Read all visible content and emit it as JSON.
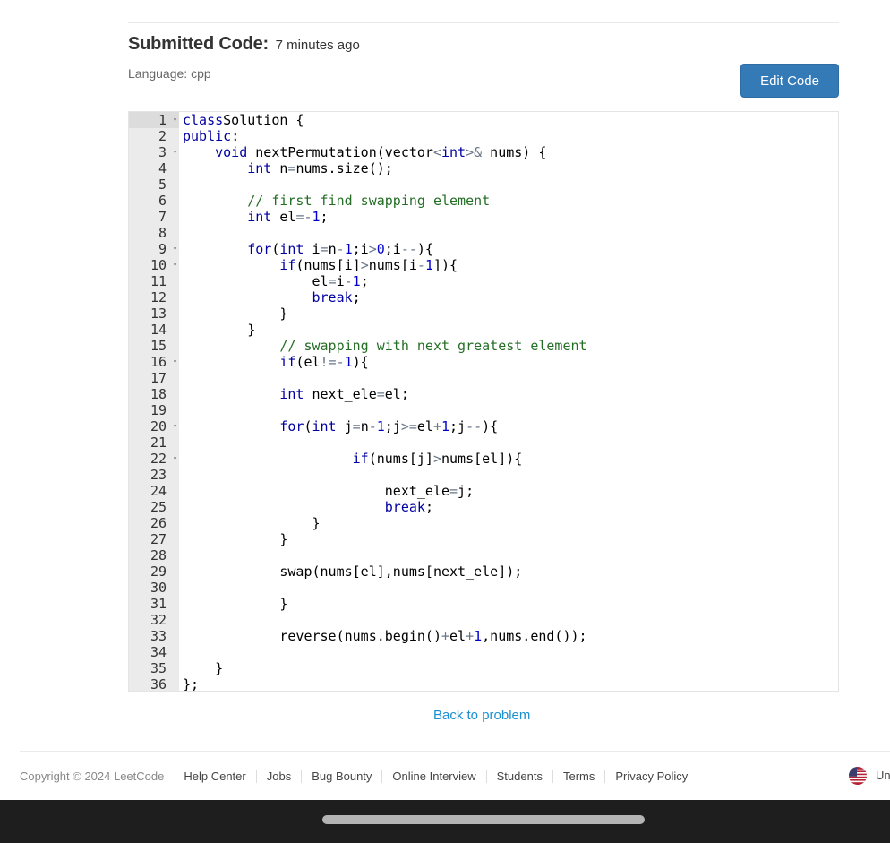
{
  "header": {
    "title_label": "Submitted Code:",
    "time_ago": "7 minutes ago",
    "language": "Language: cpp",
    "edit_button": "Edit Code"
  },
  "code_lines": [
    {
      "n": "1",
      "fold": true,
      "segs": [
        [
          "kw",
          "class"
        ],
        [
          "",
          "Solution {"
        ]
      ]
    },
    {
      "n": "2",
      "fold": false,
      "segs": [
        [
          "kw",
          "public"
        ],
        [
          "",
          ":"
        ]
      ]
    },
    {
      "n": "3",
      "fold": true,
      "segs": [
        [
          "",
          "    "
        ],
        [
          "kw",
          "void"
        ],
        [
          "",
          " nextPermutation(vector"
        ],
        [
          "op",
          "<"
        ],
        [
          "typ",
          "int"
        ],
        [
          "op",
          ">&"
        ],
        [
          "",
          " nums) {"
        ]
      ]
    },
    {
      "n": "4",
      "fold": false,
      "segs": [
        [
          "",
          "        "
        ],
        [
          "typ",
          "int"
        ],
        [
          "",
          " n"
        ],
        [
          "op",
          "="
        ],
        [
          "",
          "nums.size();"
        ]
      ]
    },
    {
      "n": "5",
      "fold": false,
      "segs": [
        [
          "",
          ""
        ]
      ]
    },
    {
      "n": "6",
      "fold": false,
      "segs": [
        [
          "",
          "        "
        ],
        [
          "cm",
          "// first find swapping element"
        ]
      ]
    },
    {
      "n": "7",
      "fold": false,
      "segs": [
        [
          "",
          "        "
        ],
        [
          "typ",
          "int"
        ],
        [
          "",
          " el"
        ],
        [
          "op",
          "=-"
        ],
        [
          "num",
          "1"
        ],
        [
          "",
          ";"
        ]
      ]
    },
    {
      "n": "8",
      "fold": false,
      "segs": [
        [
          "",
          ""
        ]
      ]
    },
    {
      "n": "9",
      "fold": true,
      "segs": [
        [
          "",
          "        "
        ],
        [
          "kw",
          "for"
        ],
        [
          "",
          "("
        ],
        [
          "typ",
          "int"
        ],
        [
          "",
          " i"
        ],
        [
          "op",
          "="
        ],
        [
          "",
          "n"
        ],
        [
          "op",
          "-"
        ],
        [
          "num",
          "1"
        ],
        [
          "",
          ";i"
        ],
        [
          "op",
          ">"
        ],
        [
          "num",
          "0"
        ],
        [
          "",
          ";i"
        ],
        [
          "op",
          "--"
        ],
        [
          "",
          "){"
        ]
      ]
    },
    {
      "n": "10",
      "fold": true,
      "segs": [
        [
          "",
          "            "
        ],
        [
          "kw",
          "if"
        ],
        [
          "",
          "(nums[i]"
        ],
        [
          "op",
          ">"
        ],
        [
          "",
          "nums[i"
        ],
        [
          "op",
          "-"
        ],
        [
          "num",
          "1"
        ],
        [
          "",
          "]){"
        ]
      ]
    },
    {
      "n": "11",
      "fold": false,
      "segs": [
        [
          "",
          "                el"
        ],
        [
          "op",
          "="
        ],
        [
          "",
          "i"
        ],
        [
          "op",
          "-"
        ],
        [
          "num",
          "1"
        ],
        [
          "",
          ";"
        ]
      ]
    },
    {
      "n": "12",
      "fold": false,
      "segs": [
        [
          "",
          "                "
        ],
        [
          "kw",
          "break"
        ],
        [
          "",
          ";"
        ]
      ]
    },
    {
      "n": "13",
      "fold": false,
      "segs": [
        [
          "",
          "            }"
        ]
      ]
    },
    {
      "n": "14",
      "fold": false,
      "segs": [
        [
          "",
          "        }"
        ]
      ]
    },
    {
      "n": "15",
      "fold": false,
      "segs": [
        [
          "",
          "            "
        ],
        [
          "cm",
          "// swapping with next greatest element"
        ]
      ]
    },
    {
      "n": "16",
      "fold": true,
      "segs": [
        [
          "",
          "            "
        ],
        [
          "kw",
          "if"
        ],
        [
          "",
          "(el"
        ],
        [
          "op",
          "!=-"
        ],
        [
          "num",
          "1"
        ],
        [
          "",
          "){"
        ]
      ]
    },
    {
      "n": "17",
      "fold": false,
      "segs": [
        [
          "",
          ""
        ]
      ]
    },
    {
      "n": "18",
      "fold": false,
      "segs": [
        [
          "",
          "            "
        ],
        [
          "typ",
          "int"
        ],
        [
          "",
          " next_ele"
        ],
        [
          "op",
          "="
        ],
        [
          "",
          "el;"
        ]
      ]
    },
    {
      "n": "19",
      "fold": false,
      "segs": [
        [
          "",
          ""
        ]
      ]
    },
    {
      "n": "20",
      "fold": true,
      "segs": [
        [
          "",
          "            "
        ],
        [
          "kw",
          "for"
        ],
        [
          "",
          "("
        ],
        [
          "typ",
          "int"
        ],
        [
          "",
          " j"
        ],
        [
          "op",
          "="
        ],
        [
          "",
          "n"
        ],
        [
          "op",
          "-"
        ],
        [
          "num",
          "1"
        ],
        [
          "",
          ";j"
        ],
        [
          "op",
          ">="
        ],
        [
          "",
          "el"
        ],
        [
          "op",
          "+"
        ],
        [
          "num",
          "1"
        ],
        [
          "",
          ";j"
        ],
        [
          "op",
          "--"
        ],
        [
          "",
          "){"
        ]
      ]
    },
    {
      "n": "21",
      "fold": false,
      "segs": [
        [
          "",
          ""
        ]
      ]
    },
    {
      "n": "22",
      "fold": true,
      "segs": [
        [
          "",
          "                     "
        ],
        [
          "kw",
          "if"
        ],
        [
          "",
          "(nums[j]"
        ],
        [
          "op",
          ">"
        ],
        [
          "",
          "nums[el]){"
        ]
      ]
    },
    {
      "n": "23",
      "fold": false,
      "segs": [
        [
          "",
          ""
        ]
      ]
    },
    {
      "n": "24",
      "fold": false,
      "segs": [
        [
          "",
          "                         next_ele"
        ],
        [
          "op",
          "="
        ],
        [
          "",
          "j;"
        ]
      ]
    },
    {
      "n": "25",
      "fold": false,
      "segs": [
        [
          "",
          "                         "
        ],
        [
          "kw",
          "break"
        ],
        [
          "",
          ";"
        ]
      ]
    },
    {
      "n": "26",
      "fold": false,
      "segs": [
        [
          "",
          "                }"
        ]
      ]
    },
    {
      "n": "27",
      "fold": false,
      "segs": [
        [
          "",
          "            }"
        ]
      ]
    },
    {
      "n": "28",
      "fold": false,
      "segs": [
        [
          "",
          ""
        ]
      ]
    },
    {
      "n": "29",
      "fold": false,
      "segs": [
        [
          "",
          "            swap(nums[el],nums[next_ele]);"
        ]
      ]
    },
    {
      "n": "30",
      "fold": false,
      "segs": [
        [
          "",
          ""
        ]
      ]
    },
    {
      "n": "31",
      "fold": false,
      "segs": [
        [
          "",
          "            }"
        ]
      ]
    },
    {
      "n": "32",
      "fold": false,
      "segs": [
        [
          "",
          ""
        ]
      ]
    },
    {
      "n": "33",
      "fold": false,
      "segs": [
        [
          "",
          "            reverse(nums.begin()"
        ],
        [
          "op",
          "+"
        ],
        [
          "",
          "el"
        ],
        [
          "op",
          "+"
        ],
        [
          "num",
          "1"
        ],
        [
          "",
          ",nums.end());"
        ]
      ]
    },
    {
      "n": "34",
      "fold": false,
      "segs": [
        [
          "",
          ""
        ]
      ]
    },
    {
      "n": "35",
      "fold": false,
      "segs": [
        [
          "",
          "    }"
        ]
      ]
    },
    {
      "n": "36",
      "fold": false,
      "segs": [
        [
          "",
          "};"
        ]
      ]
    }
  ],
  "back_link": "Back to problem",
  "footer": {
    "copyright": "Copyright © 2024 LeetCode",
    "links": [
      "Help Center",
      "Jobs",
      "Bug Bounty",
      "Online Interview",
      "Students",
      "Terms",
      "Privacy Policy"
    ],
    "language_short": "Un",
    "flag_icon": "us-flag-icon"
  },
  "colors": {
    "button": "#337ab7",
    "link": "#1a90d1",
    "keyword": "#0000a2",
    "comment": "#236e24"
  }
}
